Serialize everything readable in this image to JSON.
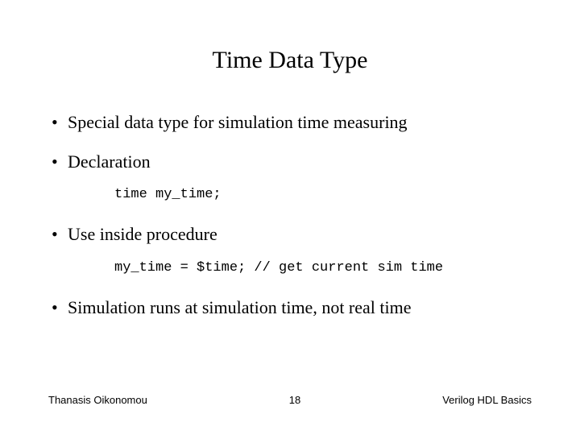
{
  "title": "Time Data Type",
  "bullets": {
    "b1": "Special data type for simulation time measuring",
    "b2": "Declaration",
    "b3": "Use inside procedure",
    "b4": "Simulation runs at simulation time, not real time"
  },
  "code": {
    "c1": "time my_time;",
    "c2": "my_time = $time; // get current sim time"
  },
  "footer": {
    "author": "Thanasis Oikonomou",
    "page": "18",
    "topic": "Verilog HDL Basics"
  }
}
